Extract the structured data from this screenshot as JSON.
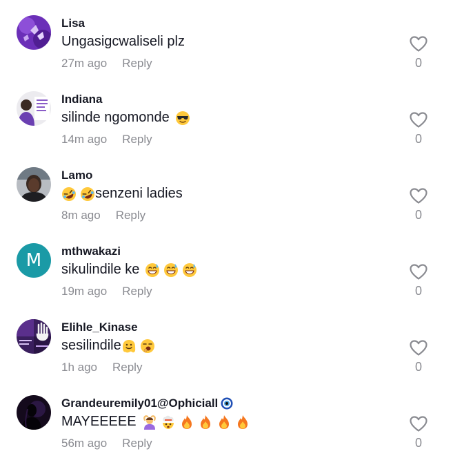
{
  "comments": [
    {
      "username": "Lisa",
      "text": "Ungasigcwaliseli plz",
      "time": "27m ago",
      "reply": "Reply",
      "likes": "0",
      "avatar_icon": "purple-butterflies-photo"
    },
    {
      "username": "Indiana",
      "text": "silinde ngomonde",
      "time": "14m ago",
      "reply": "Reply",
      "likes": "0",
      "avatar_icon": "woman-with-flyer-photo",
      "emojis": [
        "smiling-face-with-sunglasses-emoji"
      ]
    },
    {
      "username": "Lamo",
      "text": "senzeni ladies",
      "time": "8m ago",
      "reply": "Reply",
      "likes": "0",
      "avatar_icon": "woman-portrait-photo",
      "emojis": [
        "rolling-on-floor-laughing-emoji",
        "rolling-on-floor-laughing-emoji"
      ]
    },
    {
      "username": "mthwakazi",
      "text": "sikulindile ke",
      "time": "19m ago",
      "reply": "Reply",
      "likes": "0",
      "avatar_letter": "M",
      "avatar_color": "#1a9aa6",
      "emojis": [
        "grinning-face-with-sweat-emoji",
        "grinning-face-with-sweat-emoji",
        "grinning-face-with-sweat-emoji"
      ]
    },
    {
      "username": "Elihle_Kinase",
      "text": "sesilindile",
      "time": "1h ago",
      "reply": "Reply",
      "likes": "0",
      "avatar_icon": "purple-hand-poster-photo",
      "emojis": [
        "melting-face-emoji",
        "yawning-face-emoji"
      ]
    },
    {
      "username": "Grandeuremily01@Ophiciall",
      "text": "MAYEEEEE",
      "time": "56m ago",
      "reply": "Reply",
      "likes": "0",
      "avatar_icon": "dark-silhouette-photo",
      "badge_icon": "nazar-amulet-emoji",
      "emojis": [
        "person-gesturing-ok-emoji",
        "exploding-head-emoji",
        "fire-emoji",
        "fire-emoji",
        "fire-emoji",
        "fire-emoji"
      ]
    }
  ],
  "colors": {
    "text": "#161823",
    "secondary_text": "#8a8b91",
    "heart_outline": "#8a8b91"
  }
}
